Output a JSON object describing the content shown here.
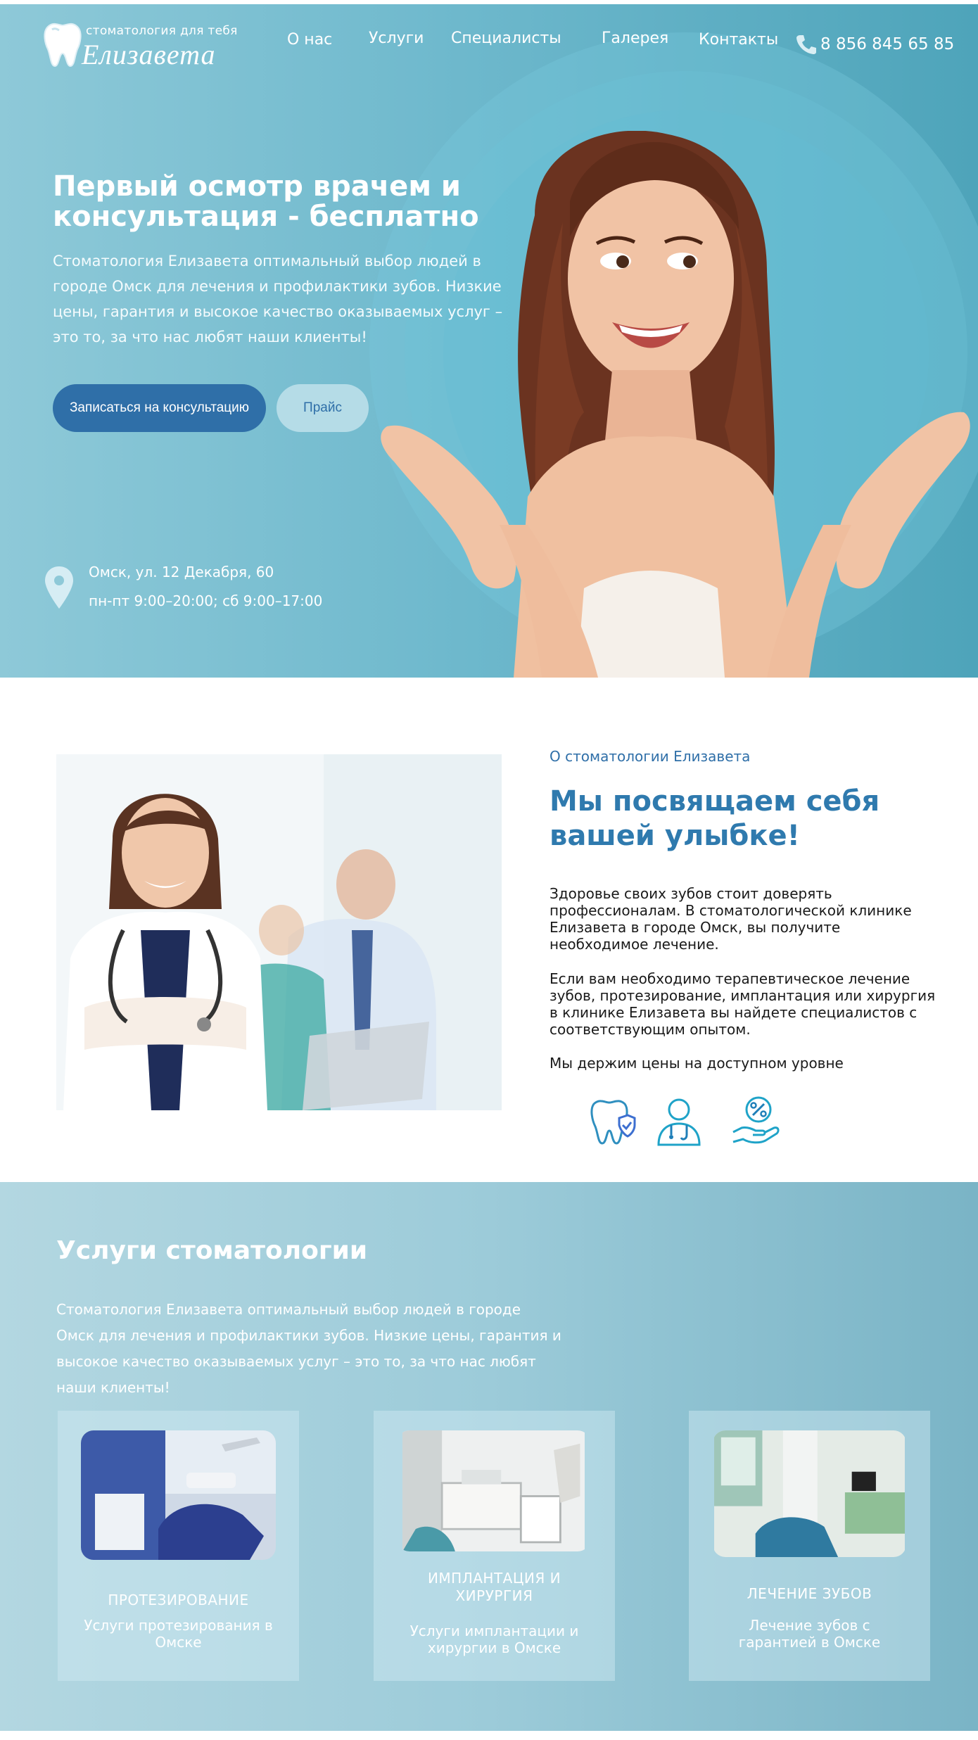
{
  "header": {
    "logo_small": "стоматология для тебя",
    "logo_big": "Елизавета",
    "nav": [
      {
        "label": "О нас"
      },
      {
        "label": "Услуги"
      },
      {
        "label": "Специалисты"
      },
      {
        "label": "Галерея"
      },
      {
        "label": "Контакты"
      }
    ],
    "phone": "8 856 845 65 85"
  },
  "hero": {
    "title": "Первый осмотр врачем и консультация - бесплатно",
    "text": "Стоматология Елизавета оптимальный выбор людей в городе Омск для лечения и профилактики зубов. Низкие цены, гарантия и высокое качество оказываемых услуг – это то, за что нас любят наши клиенты!",
    "btn_primary": "Записаться на консультацию",
    "btn_secondary": "Прайс",
    "address": "Омск,  ул. 12 Декабря, 60",
    "hours": "пн-пт 9:00–20:00; сб 9:00–17:00"
  },
  "about": {
    "subtitle": "О стоматологии Елизавета",
    "title": "Мы посвящаем себя вашей улыбке!",
    "p1": "Здоровье своих зубов стоит доверять профессионалам. В стоматологической клинике Елизавета в городе Омск, вы получите необходимое лечение.",
    "p2": "Если вам необходимо терапевтическое лечение зубов, протезирование, имплантация или хирургия в клинике Елизавета вы найдете специалистов с соответствующим опытом.",
    "p3": "Мы держим цены на доступном уровне",
    "features": [
      {
        "icon": "tooth-shield-icon"
      },
      {
        "icon": "doctor-icon"
      },
      {
        "icon": "discount-hand-icon"
      }
    ]
  },
  "services": {
    "title": "Услуги стоматологии",
    "text": "Стоматология Елизавета оптимальный выбор людей в городе Омск для лечения и профилактики зубов. Низкие цены, гарантия и высокое качество оказываемых услуг – это то, за что нас любят наши клиенты!",
    "cards": [
      {
        "name": "Протезирование",
        "desc": "Услуги протезирования в Омске"
      },
      {
        "name": "Имплантация и хирургия",
        "desc": "Услуги имплантации и хирургии в Омске"
      },
      {
        "name": "Лечение зубов",
        "desc": "Лечение зубов с гарантией в Омске"
      }
    ]
  },
  "colors": {
    "accent": "#2f6fa8",
    "hero_bg": "#6fb9cd",
    "services_bg": "#9ccbd9"
  }
}
